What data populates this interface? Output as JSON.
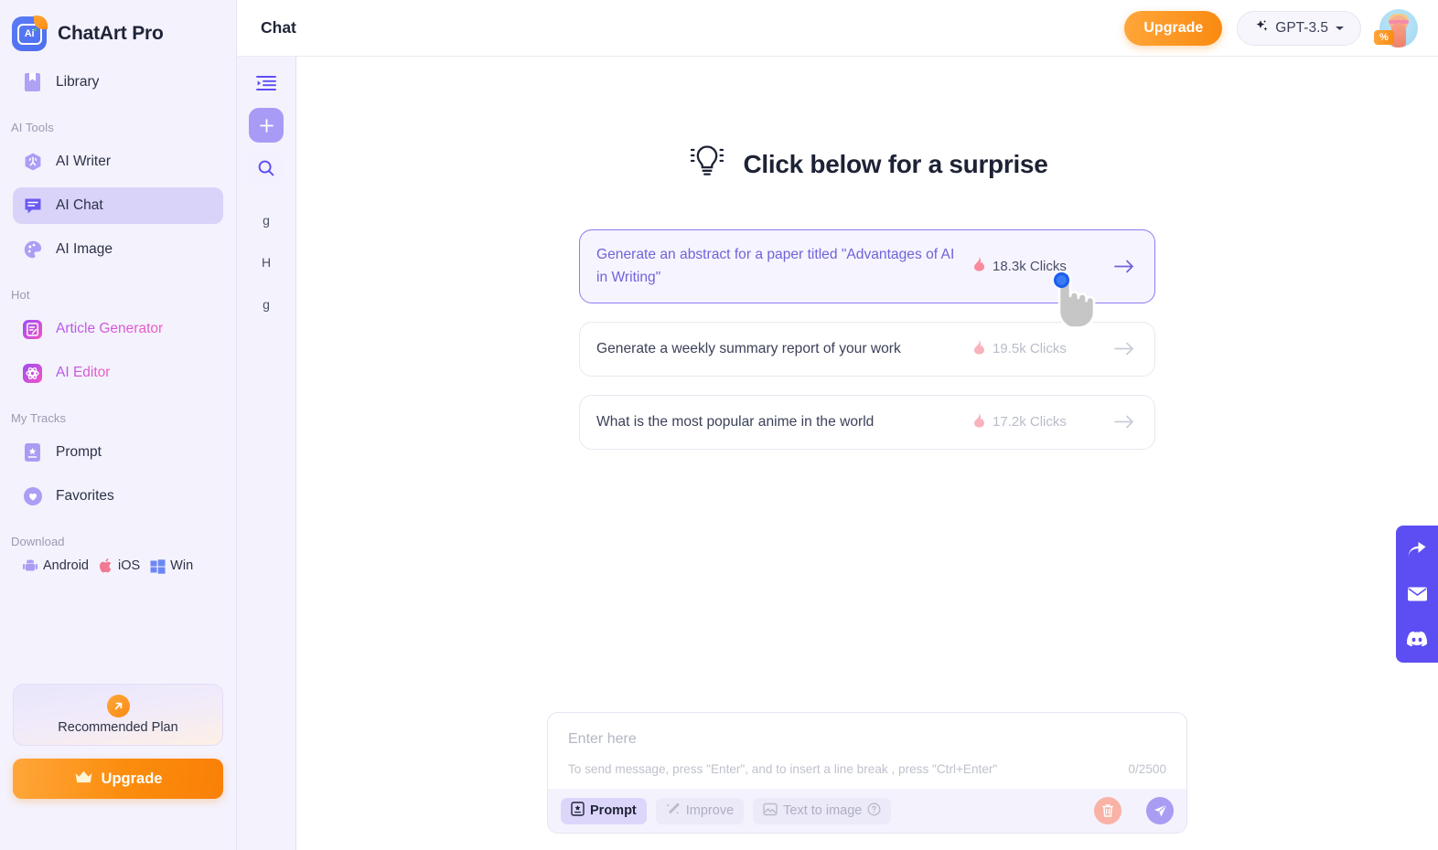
{
  "brand": {
    "name": "ChatArt Pro",
    "logo_icon": "ai-logo-icon"
  },
  "sidebar": {
    "library": {
      "label": "Library",
      "icon": "book-icon"
    },
    "sections": [
      {
        "label": "AI Tools",
        "items": [
          {
            "label": "AI Writer",
            "icon": "writer-icon",
            "active": false
          },
          {
            "label": "AI Chat",
            "icon": "chat-bubble-icon",
            "active": true
          },
          {
            "label": "AI Image",
            "icon": "palette-icon",
            "active": false
          }
        ]
      },
      {
        "label": "Hot",
        "items": [
          {
            "label": "Article Generator",
            "icon": "article-generator-icon",
            "active": false
          },
          {
            "label": "AI Editor",
            "icon": "ai-editor-icon",
            "active": false
          }
        ]
      },
      {
        "label": "My Tracks",
        "items": [
          {
            "label": "Prompt",
            "icon": "prompt-icon",
            "active": false
          },
          {
            "label": "Favorites",
            "icon": "heart-icon",
            "active": false
          }
        ]
      }
    ],
    "download": {
      "label": "Download",
      "items": [
        {
          "label": "Android",
          "icon": "android-icon"
        },
        {
          "label": "iOS",
          "icon": "apple-icon"
        },
        {
          "label": "Win",
          "icon": "windows-icon"
        }
      ]
    },
    "recommended_plan": {
      "label": "Recommended Plan",
      "icon": "arrow-up-right-icon"
    },
    "upgrade": {
      "label": "Upgrade",
      "icon": "crown-icon"
    }
  },
  "topbar": {
    "title": "Chat",
    "upgrade_label": "Upgrade",
    "model": {
      "label": "GPT-3.5",
      "icon": "sparkle-icon",
      "caret": "chevron-down-icon"
    },
    "avatar_badge": "%"
  },
  "rail": {
    "collapse_icon": "collapse-sidebar-icon",
    "new_chat_icon": "plus-icon",
    "search_icon": "search-icon",
    "chats": [
      "g",
      "H",
      "g"
    ]
  },
  "main": {
    "headline": "Click below for a surprise",
    "headline_icon": "lightbulb-icon",
    "cards": [
      {
        "text": "Generate an abstract for a paper titled \"Advantages of AI in Writing\"",
        "clicks": "18.3k Clicks",
        "selected": true
      },
      {
        "text": "Generate a weekly summary report of your work",
        "clicks": "19.5k Clicks",
        "selected": false
      },
      {
        "text": "What is the most popular anime in the world",
        "clicks": "17.2k Clicks",
        "selected": false
      }
    ]
  },
  "composer": {
    "placeholder": "Enter here",
    "value": "",
    "hint": "To send message, press \"Enter\", and to insert a line break , press \"Ctrl+Enter\"",
    "counter": "0/2500",
    "chips": [
      {
        "label": "Prompt",
        "icon": "prompt-icon",
        "active": true
      },
      {
        "label": "Improve",
        "icon": "magic-wand-icon",
        "active": false
      },
      {
        "label": "Text to image",
        "icon": "image-icon",
        "active": false,
        "help": "help-circle-icon"
      }
    ],
    "clear_icon": "trash-icon",
    "send_icon": "send-icon"
  },
  "dock": [
    {
      "icon": "share-icon"
    },
    {
      "icon": "email-icon"
    },
    {
      "icon": "discord-icon"
    }
  ],
  "colors": {
    "brand_purple": "#5c4ef2",
    "sidebar_bg": "#f4f2fd",
    "accent_orange": "#f98a10",
    "selected_card_border": "#8d7cf0",
    "flame_pink": "#f98a9c"
  }
}
